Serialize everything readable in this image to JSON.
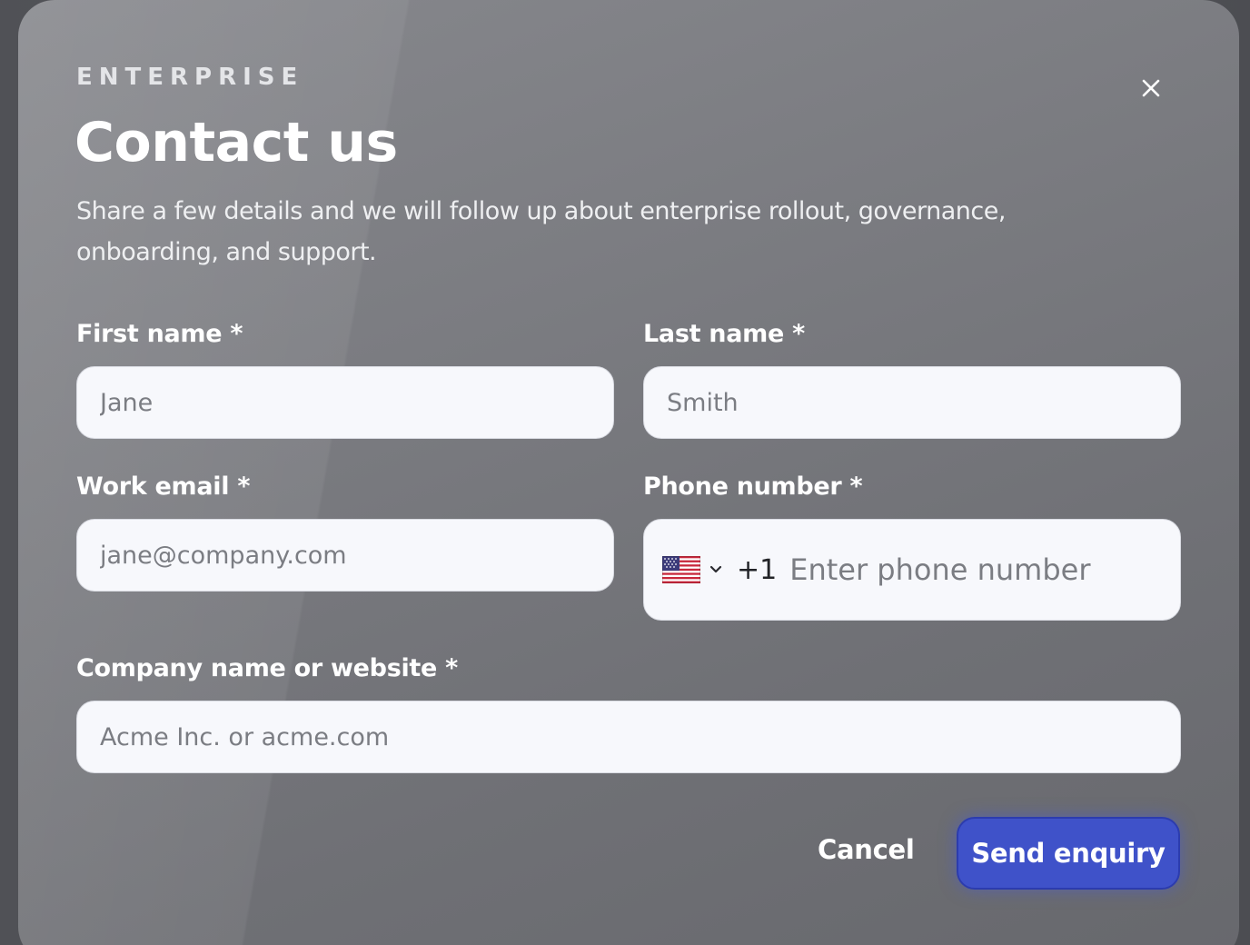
{
  "modal": {
    "eyebrow": "ENTERPRISE",
    "title": "Contact us",
    "description": "Share a few details and we will follow up about enterprise rollout, governance, onboarding, and support."
  },
  "form": {
    "first_name": {
      "label": "First name *",
      "placeholder": "Jane",
      "value": ""
    },
    "last_name": {
      "label": "Last name *",
      "placeholder": "Smith",
      "value": ""
    },
    "work_email": {
      "label": "Work email *",
      "placeholder": "jane@company.com",
      "value": ""
    },
    "phone": {
      "label": "Phone number *",
      "country_flag": "us-flag-icon",
      "country_code": "+1",
      "placeholder": "Enter phone number",
      "value": ""
    },
    "company": {
      "label": "Company name or website *",
      "placeholder": "Acme Inc. or acme.com",
      "value": ""
    }
  },
  "actions": {
    "cancel_label": "Cancel",
    "submit_label": "Send enquiry"
  },
  "colors": {
    "primary": "#3f52c9",
    "input_bg": "#f7f8fc"
  }
}
